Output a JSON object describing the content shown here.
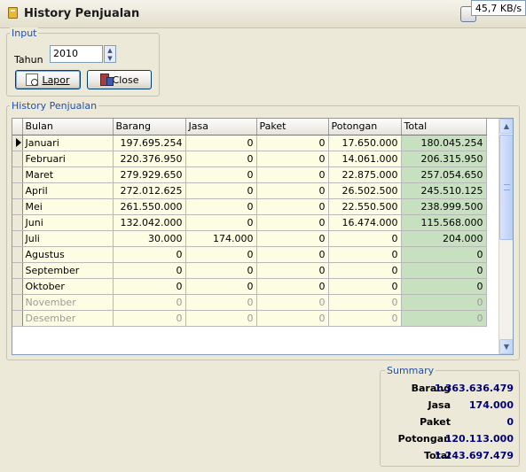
{
  "window": {
    "title": "History Penjualan",
    "speed": "45,7 KB/s"
  },
  "input_group": {
    "caption": "Input",
    "tahun_label": "Tahun",
    "tahun_value": "2010",
    "lapor_label": "Lapor",
    "close_label": "Close"
  },
  "history_group": {
    "caption": "History Penjualan",
    "columns": [
      "Bulan",
      "Barang",
      "Jasa",
      "Paket",
      "Potongan",
      "Total"
    ],
    "rows": [
      {
        "bulan": "Januari",
        "barang": "197.695.254",
        "jasa": "0",
        "paket": "0",
        "potongan": "17.650.000",
        "total": "180.045.254"
      },
      {
        "bulan": "Februari",
        "barang": "220.376.950",
        "jasa": "0",
        "paket": "0",
        "potongan": "14.061.000",
        "total": "206.315.950"
      },
      {
        "bulan": "Maret",
        "barang": "279.929.650",
        "jasa": "0",
        "paket": "0",
        "potongan": "22.875.000",
        "total": "257.054.650"
      },
      {
        "bulan": "April",
        "barang": "272.012.625",
        "jasa": "0",
        "paket": "0",
        "potongan": "26.502.500",
        "total": "245.510.125"
      },
      {
        "bulan": "Mei",
        "barang": "261.550.000",
        "jasa": "0",
        "paket": "0",
        "potongan": "22.550.500",
        "total": "238.999.500"
      },
      {
        "bulan": "Juni",
        "barang": "132.042.000",
        "jasa": "0",
        "paket": "0",
        "potongan": "16.474.000",
        "total": "115.568.000"
      },
      {
        "bulan": "Juli",
        "barang": "30.000",
        "jasa": "174.000",
        "paket": "0",
        "potongan": "0",
        "total": "204.000"
      },
      {
        "bulan": "Agustus",
        "barang": "0",
        "jasa": "0",
        "paket": "0",
        "potongan": "0",
        "total": "0"
      },
      {
        "bulan": "September",
        "barang": "0",
        "jasa": "0",
        "paket": "0",
        "potongan": "0",
        "total": "0"
      },
      {
        "bulan": "Oktober",
        "barang": "0",
        "jasa": "0",
        "paket": "0",
        "potongan": "0",
        "total": "0"
      },
      {
        "bulan": "November",
        "barang": "0",
        "jasa": "0",
        "paket": "0",
        "potongan": "0",
        "total": "0"
      },
      {
        "bulan": "Desember",
        "barang": "0",
        "jasa": "0",
        "paket": "0",
        "potongan": "0",
        "total": "0"
      }
    ]
  },
  "summary": {
    "caption": "Summary",
    "barang_label": "Barang",
    "barang_value": "1.363.636.479",
    "jasa_label": "Jasa",
    "jasa_value": "174.000",
    "paket_label": "Paket",
    "paket_value": "0",
    "potongan_label": "Potongan",
    "potongan_value": "120.113.000",
    "total_label": "Total",
    "total_value": "1.243.697.479"
  },
  "colors": {
    "window_bg": "#ece9d8",
    "group_caption": "#1f4fb0",
    "row_bg": "#fdfde3",
    "total_col_bg": "#c6e0c0",
    "summary_value": "#00007a"
  }
}
